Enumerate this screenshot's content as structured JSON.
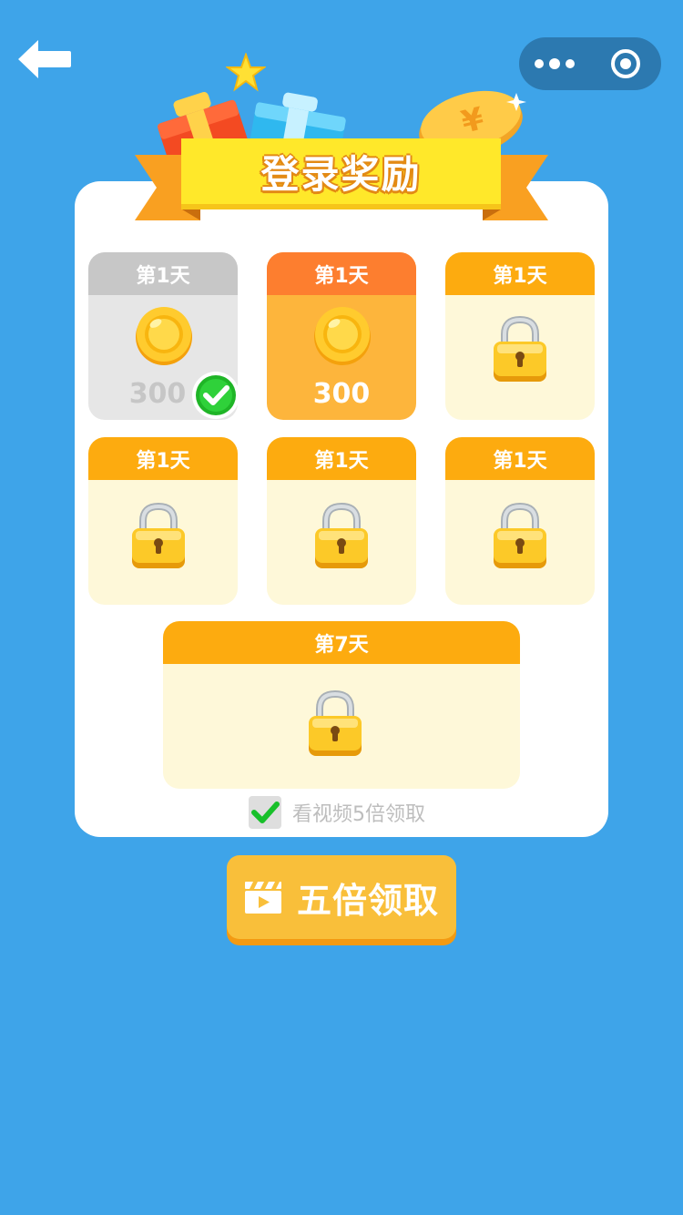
{
  "nav": {
    "back_icon": "back-arrow-icon",
    "more_icon": "more-dots-icon",
    "close_icon": "target-close-icon"
  },
  "banner": {
    "title": "登录奖励"
  },
  "days": [
    {
      "label": "第1天",
      "state": "claimed",
      "amount": "300",
      "icon": "coin-icon"
    },
    {
      "label": "第1天",
      "state": "current",
      "amount": "300",
      "icon": "coin-icon"
    },
    {
      "label": "第1天",
      "state": "locked",
      "icon": "lock-icon"
    },
    {
      "label": "第1天",
      "state": "locked",
      "icon": "lock-icon"
    },
    {
      "label": "第1天",
      "state": "locked",
      "icon": "lock-icon"
    },
    {
      "label": "第1天",
      "state": "locked",
      "icon": "lock-icon"
    },
    {
      "label": "第7天",
      "state": "locked",
      "icon": "lock-icon"
    }
  ],
  "video_option": {
    "label": "看视频5倍领取",
    "checked": true
  },
  "claim_button": {
    "label": "五倍领取",
    "icon": "clapperboard-icon"
  },
  "colors": {
    "background": "#3ea4e9",
    "header_active": "#fdab0f",
    "header_current": "#fd7e2f",
    "header_claimed": "#c7c7c7",
    "button": "#f9bf3a"
  }
}
